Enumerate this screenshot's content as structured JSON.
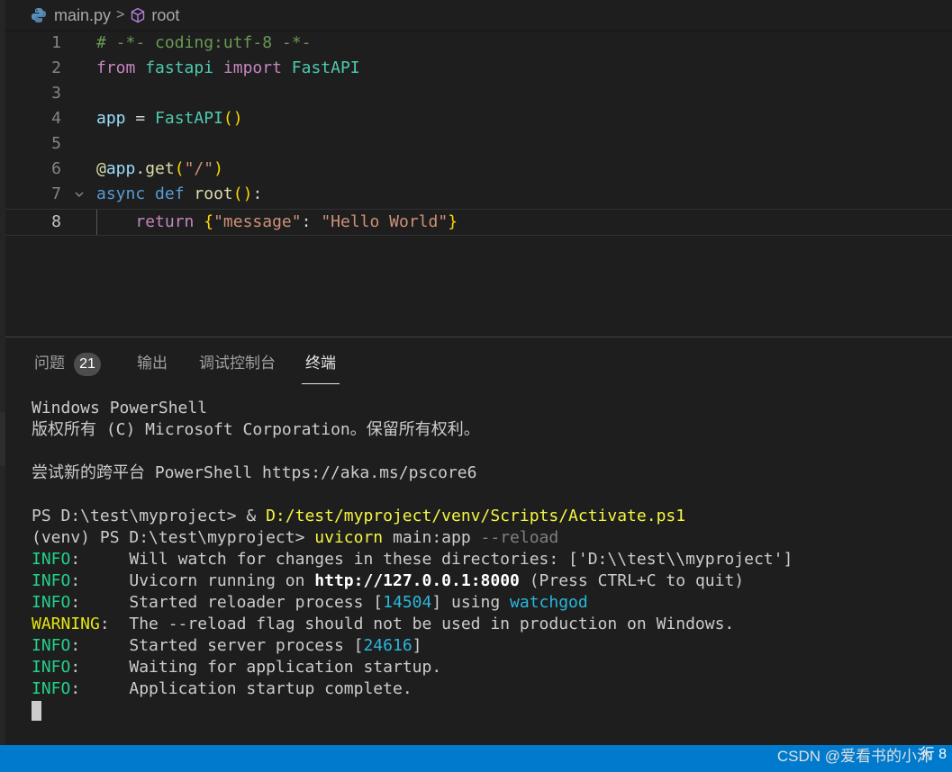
{
  "breadcrumb": {
    "file": "main.py",
    "separator": ">",
    "symbol": "root"
  },
  "editor": {
    "lines": [
      {
        "n": "1",
        "tokens": [
          [
            "c-com",
            "# -*- coding:utf-8 -*-"
          ]
        ]
      },
      {
        "n": "2",
        "tokens": [
          [
            "c-kw",
            "from"
          ],
          [
            "c-op",
            " "
          ],
          [
            "c-mod",
            "fastapi"
          ],
          [
            "c-op",
            " "
          ],
          [
            "c-kw",
            "import"
          ],
          [
            "c-op",
            " "
          ],
          [
            "c-mod",
            "FastAPI"
          ]
        ]
      },
      {
        "n": "3",
        "tokens": []
      },
      {
        "n": "4",
        "tokens": [
          [
            "c-var",
            "app"
          ],
          [
            "c-op",
            " = "
          ],
          [
            "c-mod",
            "FastAPI"
          ],
          [
            "c-br1",
            "()"
          ]
        ]
      },
      {
        "n": "5",
        "tokens": []
      },
      {
        "n": "6",
        "tokens": [
          [
            "c-fn",
            "@"
          ],
          [
            "c-var",
            "app"
          ],
          [
            "c-op",
            "."
          ],
          [
            "c-fn",
            "get"
          ],
          [
            "c-br1",
            "("
          ],
          [
            "c-str",
            "\"/\""
          ],
          [
            "c-br1",
            ")"
          ]
        ]
      },
      {
        "n": "7",
        "tokens": [
          [
            "c-def",
            "async"
          ],
          [
            "c-op",
            " "
          ],
          [
            "c-def",
            "def"
          ],
          [
            "c-op",
            " "
          ],
          [
            "c-fn",
            "root"
          ],
          [
            "c-br1",
            "()"
          ],
          [
            "c-op",
            ":"
          ]
        ],
        "fold": true
      },
      {
        "n": "8",
        "tokens": [
          [
            "c-op",
            "    "
          ],
          [
            "c-kw",
            "return"
          ],
          [
            "c-op",
            " "
          ],
          [
            "c-br1",
            "{"
          ],
          [
            "c-str",
            "\"message\""
          ],
          [
            "c-op",
            ": "
          ],
          [
            "c-str",
            "\"Hello World\""
          ],
          [
            "c-br1",
            "}"
          ]
        ],
        "current": true
      }
    ]
  },
  "panel": {
    "tabs": [
      {
        "label": "问题",
        "badge": "21"
      },
      {
        "label": "输出"
      },
      {
        "label": "调试控制台"
      },
      {
        "label": "终端",
        "active": true
      }
    ]
  },
  "terminal": {
    "lines": [
      [
        [
          "",
          "Windows PowerShell"
        ]
      ],
      [
        [
          "",
          "版权所有 (C) Microsoft Corporation。保留所有权利。"
        ]
      ],
      [],
      [
        [
          "",
          "尝试新的跨平台 PowerShell https://aka.ms/pscore6"
        ]
      ],
      [],
      [
        [
          "",
          "PS D:\\test\\myproject> & "
        ],
        [
          "t-yellow",
          "D:/test/myproject/venv/Scripts/Activate.ps1"
        ]
      ],
      [
        [
          "",
          "(venv) PS D:\\test\\myproject> "
        ],
        [
          "t-yellow",
          "uvicorn"
        ],
        [
          "",
          " main:app "
        ],
        [
          "t-gray",
          "--reload"
        ]
      ],
      [
        [
          "t-green",
          "INFO"
        ],
        [
          "",
          ":     Will watch for changes in these directories: ['D:\\\\test\\\\myproject']"
        ]
      ],
      [
        [
          "t-green",
          "INFO"
        ],
        [
          "",
          ":     Uvicorn running on "
        ],
        [
          "t-bold",
          "http://127.0.0.1:8000"
        ],
        [
          "",
          " (Press CTRL+C to quit)"
        ]
      ],
      [
        [
          "t-green",
          "INFO"
        ],
        [
          "",
          ":     Started reloader process ["
        ],
        [
          "t-blue",
          "14504"
        ],
        [
          "",
          "] using "
        ],
        [
          "t-blue",
          "watchgod"
        ]
      ],
      [
        [
          "t-warn",
          "WARNING"
        ],
        [
          "",
          ":  The --reload flag should not be used in production on Windows."
        ]
      ],
      [
        [
          "t-green",
          "INFO"
        ],
        [
          "",
          ":     Started server process ["
        ],
        [
          "t-blue",
          "24616"
        ],
        [
          "",
          "]"
        ]
      ],
      [
        [
          "t-green",
          "INFO"
        ],
        [
          "",
          ":     Waiting for application startup."
        ]
      ],
      [
        [
          "t-green",
          "INFO"
        ],
        [
          "",
          ":     Application startup complete."
        ]
      ]
    ]
  },
  "statusbar": {
    "right_text": "行 8"
  },
  "watermark": "CSDN @爱看书的小沐",
  "colors": {
    "statusbar": "#007acc",
    "editor_bg": "#1e1e1e"
  }
}
